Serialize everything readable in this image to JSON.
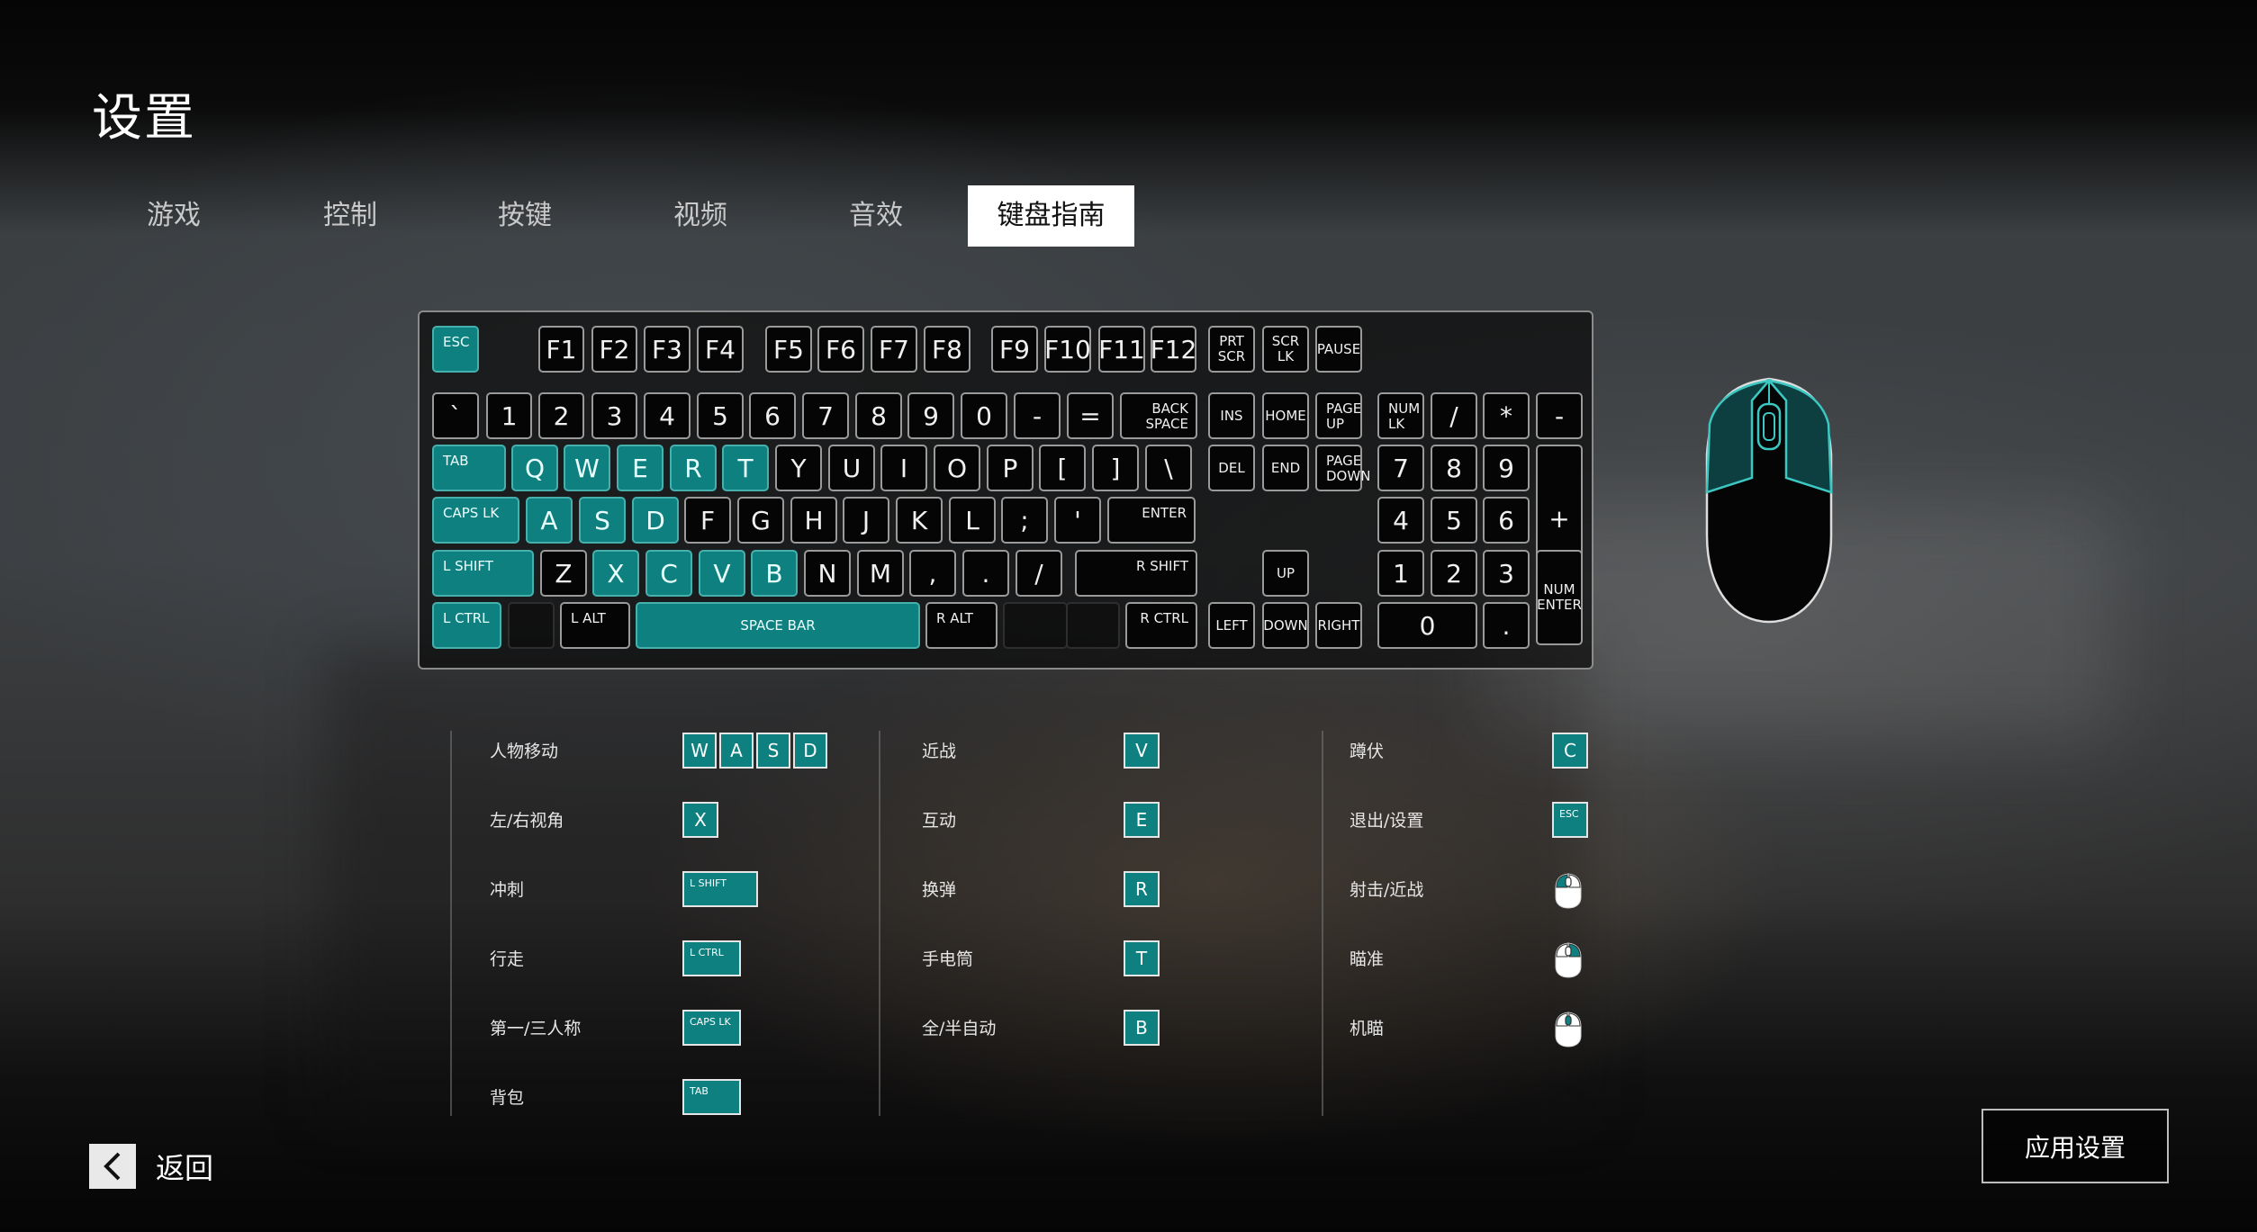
{
  "title": "设置",
  "tabs": [
    "游戏",
    "控制",
    "按键",
    "视频",
    "音效",
    "键盘指南"
  ],
  "active_tab": "键盘指南",
  "accent_color": "#0e8080",
  "keyboard": {
    "row0": [
      "ESC",
      "F1",
      "F2",
      "F3",
      "F4",
      "F5",
      "F6",
      "F7",
      "F8",
      "F9",
      "F10",
      "F11",
      "F12",
      "PRT\nSCR",
      "SCR\nLK",
      "PAUSE"
    ],
    "row1": [
      "`",
      "1",
      "2",
      "3",
      "4",
      "5",
      "6",
      "7",
      "8",
      "9",
      "0",
      "-",
      "=",
      "BACK\nSPACE",
      "INS",
      "HOME",
      "PAGE\nUP",
      "NUM\nLK",
      "/",
      "*",
      "-"
    ],
    "row2": [
      "TAB",
      "Q",
      "W",
      "E",
      "R",
      "T",
      "Y",
      "U",
      "I",
      "O",
      "P",
      "[",
      "]",
      "\\",
      "DEL",
      "END",
      "PAGE\nDOWN",
      "7",
      "8",
      "9",
      "+"
    ],
    "row3": [
      "CAPS LK",
      "A",
      "S",
      "D",
      "F",
      "G",
      "H",
      "J",
      "K",
      "L",
      ";",
      "'",
      "ENTER",
      "4",
      "5",
      "6"
    ],
    "row4": [
      "L SHIFT",
      "Z",
      "X",
      "C",
      "V",
      "B",
      "N",
      "M",
      ",",
      ".",
      "/",
      "R SHIFT",
      "UP",
      "1",
      "2",
      "3",
      "NUM\nENTER"
    ],
    "row5": [
      "L CTRL",
      "L ALT",
      "SPACE BAR",
      "R ALT",
      "R CTRL",
      "LEFT",
      "DOWN",
      "RIGHT",
      "0",
      "."
    ],
    "highlighted": [
      "ESC",
      "TAB",
      "Q",
      "W",
      "E",
      "R",
      "T",
      "CAPS LK",
      "A",
      "S",
      "D",
      "L SHIFT",
      "X",
      "C",
      "V",
      "B",
      "L CTRL",
      "SPACE BAR"
    ]
  },
  "guide": {
    "col1": [
      {
        "label": "人物移动",
        "keys": [
          "W",
          "A",
          "S",
          "D"
        ]
      },
      {
        "label": "左/右视角",
        "keys": [
          "X"
        ]
      },
      {
        "label": "冲刺",
        "keys": [
          "L SHIFT"
        ]
      },
      {
        "label": "行走",
        "keys": [
          "L CTRL"
        ]
      },
      {
        "label": "第一/三人称",
        "keys": [
          "CAPS LK"
        ]
      },
      {
        "label": "背包",
        "keys": [
          "TAB"
        ]
      }
    ],
    "col2": [
      {
        "label": "近战",
        "keys": [
          "V"
        ]
      },
      {
        "label": "互动",
        "keys": [
          "E"
        ]
      },
      {
        "label": "换弹",
        "keys": [
          "R"
        ]
      },
      {
        "label": "手电筒",
        "keys": [
          "T"
        ]
      },
      {
        "label": "全/半自动",
        "keys": [
          "B"
        ]
      }
    ],
    "col3": [
      {
        "label": "蹲伏",
        "keys": [
          "C"
        ]
      },
      {
        "label": "退出/设置",
        "keys": [
          "ESC"
        ]
      },
      {
        "label": "射击/近战",
        "icon": "mouse-left-click-icon"
      },
      {
        "label": "瞄准",
        "icon": "mouse-right-click-icon"
      },
      {
        "label": "机瞄",
        "icon": "mouse-middle-click-icon"
      }
    ]
  },
  "footer": {
    "back_label": "返回",
    "apply_label": "应用设置"
  }
}
